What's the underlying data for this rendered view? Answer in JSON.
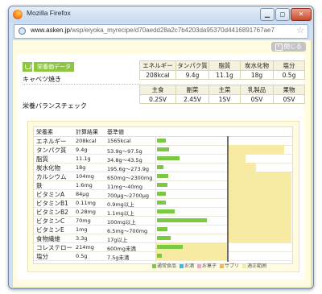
{
  "window": {
    "title": "Mozilla Firefox",
    "url_domain": "www.asken.jp",
    "url_path": "/wsp/eiyoka_myrecipe/d70aedd28a2c7b4203da95370d4416891767ae7"
  },
  "popup": {
    "close_label": "閉じる",
    "badge": "栄養価データ",
    "recipe_name": "キャベツ焼き",
    "balance_title": "栄養バランスチェック"
  },
  "nutrients_table": {
    "headers": [
      "エネルギー",
      "タンパク質",
      "脂質",
      "炭水化物",
      "塩分"
    ],
    "values": [
      "208kcal",
      "9.4g",
      "11.1g",
      "18g",
      "0.5g"
    ]
  },
  "groups_table": {
    "headers": [
      "主食",
      "副菜",
      "主菜",
      "乳製品",
      "果物"
    ],
    "values": [
      "0.2SV",
      "2.45V",
      "1SV",
      "0SV",
      "0SV"
    ]
  },
  "balance": {
    "col_nutrient": "栄養素",
    "col_result": "計算結果",
    "col_standard": "基準値",
    "rows": [
      {
        "name": "エネルギー",
        "result": "208kcal",
        "standard": "1565kcal"
      },
      {
        "name": "タンパク質",
        "result": "9.4g",
        "standard": "53.9g〜97.5g"
      },
      {
        "name": "脂質",
        "result": "11.1g",
        "standard": "34.8g〜43.5g"
      },
      {
        "name": "炭水化物",
        "result": "18g",
        "standard": "195.6g〜273.9g"
      },
      {
        "name": "カルシウム",
        "result": "104mg",
        "standard": "650mg〜2300mg"
      },
      {
        "name": "鉄",
        "result": "1.6mg",
        "standard": "11mg〜40mg"
      },
      {
        "name": "ビタミンA",
        "result": "84μg",
        "standard": "700μg〜2700μg"
      },
      {
        "name": "ビタミンB1",
        "result": "0.11mg",
        "standard": "0.9mg以上"
      },
      {
        "name": "ビタミンB2",
        "result": "0.28mg",
        "standard": "1.1mg以上"
      },
      {
        "name": "ビタミンC",
        "result": "70mg",
        "standard": "100mg以上"
      },
      {
        "name": "ビタミンE",
        "result": "1mg",
        "standard": "6.5mg〜700mg"
      },
      {
        "name": "食物繊維",
        "result": "3.3g",
        "standard": "17g以上"
      },
      {
        "name": "コレステロー",
        "result": "214mg",
        "standard": "600mg未満"
      },
      {
        "name": "塩分",
        "result": "0.5g",
        "standard": "7.5g未満"
      }
    ],
    "legend": [
      {
        "label": "通常食品",
        "color": "#7ac943"
      },
      {
        "label": "お酒",
        "color": "#46b7d8"
      },
      {
        "label": "お菓子",
        "color": "#f7a0c8"
      },
      {
        "label": "サプリ",
        "color": "#f7b54a"
      },
      {
        "label": "適正範囲",
        "color": "#f7eaa3"
      }
    ]
  },
  "chart_data": {
    "type": "bar",
    "categories": [
      "エネルギー",
      "タンパク質",
      "脂質",
      "炭水化物",
      "カルシウム",
      "鉄",
      "ビタミンA",
      "ビタミンB1",
      "ビタミンB2",
      "ビタミンC",
      "ビタミンE",
      "食物繊維",
      "コレステロー",
      "塩分"
    ],
    "series": [
      {
        "name": "通常食品",
        "values": [
          13,
          17,
          32,
          9,
          16,
          15,
          12,
          12,
          25,
          70,
          15,
          19,
          36,
          7
        ]
      }
    ],
    "range_start": [
      null,
      100,
      100,
      100,
      100,
      100,
      100,
      100,
      100,
      100,
      100,
      100,
      0,
      0
    ],
    "range_end": [
      null,
      180,
      125,
      140,
      350,
      360,
      385,
      190,
      190,
      190,
      190,
      190,
      100,
      100
    ],
    "reference": 100,
    "xlim": [
      0,
      190
    ]
  }
}
